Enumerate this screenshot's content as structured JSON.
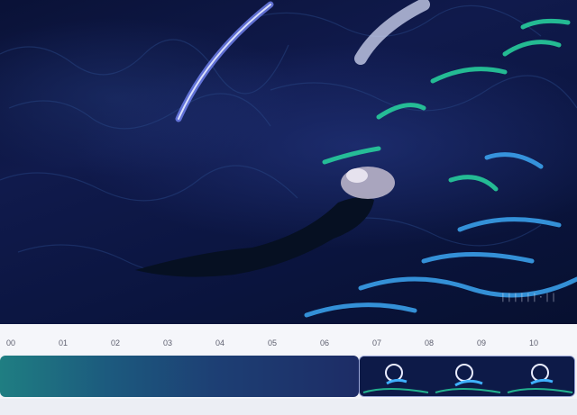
{
  "viewer": {
    "watermark": "||||||·||"
  },
  "timeline": {
    "ticks": [
      "00",
      "01",
      "02",
      "03",
      "04",
      "05",
      "06",
      "07",
      "08",
      "09",
      "10"
    ]
  },
  "colors": {
    "track_start": "#1f7e82",
    "track_end": "#1d2c66",
    "clip_border": "#9aa6d8"
  }
}
